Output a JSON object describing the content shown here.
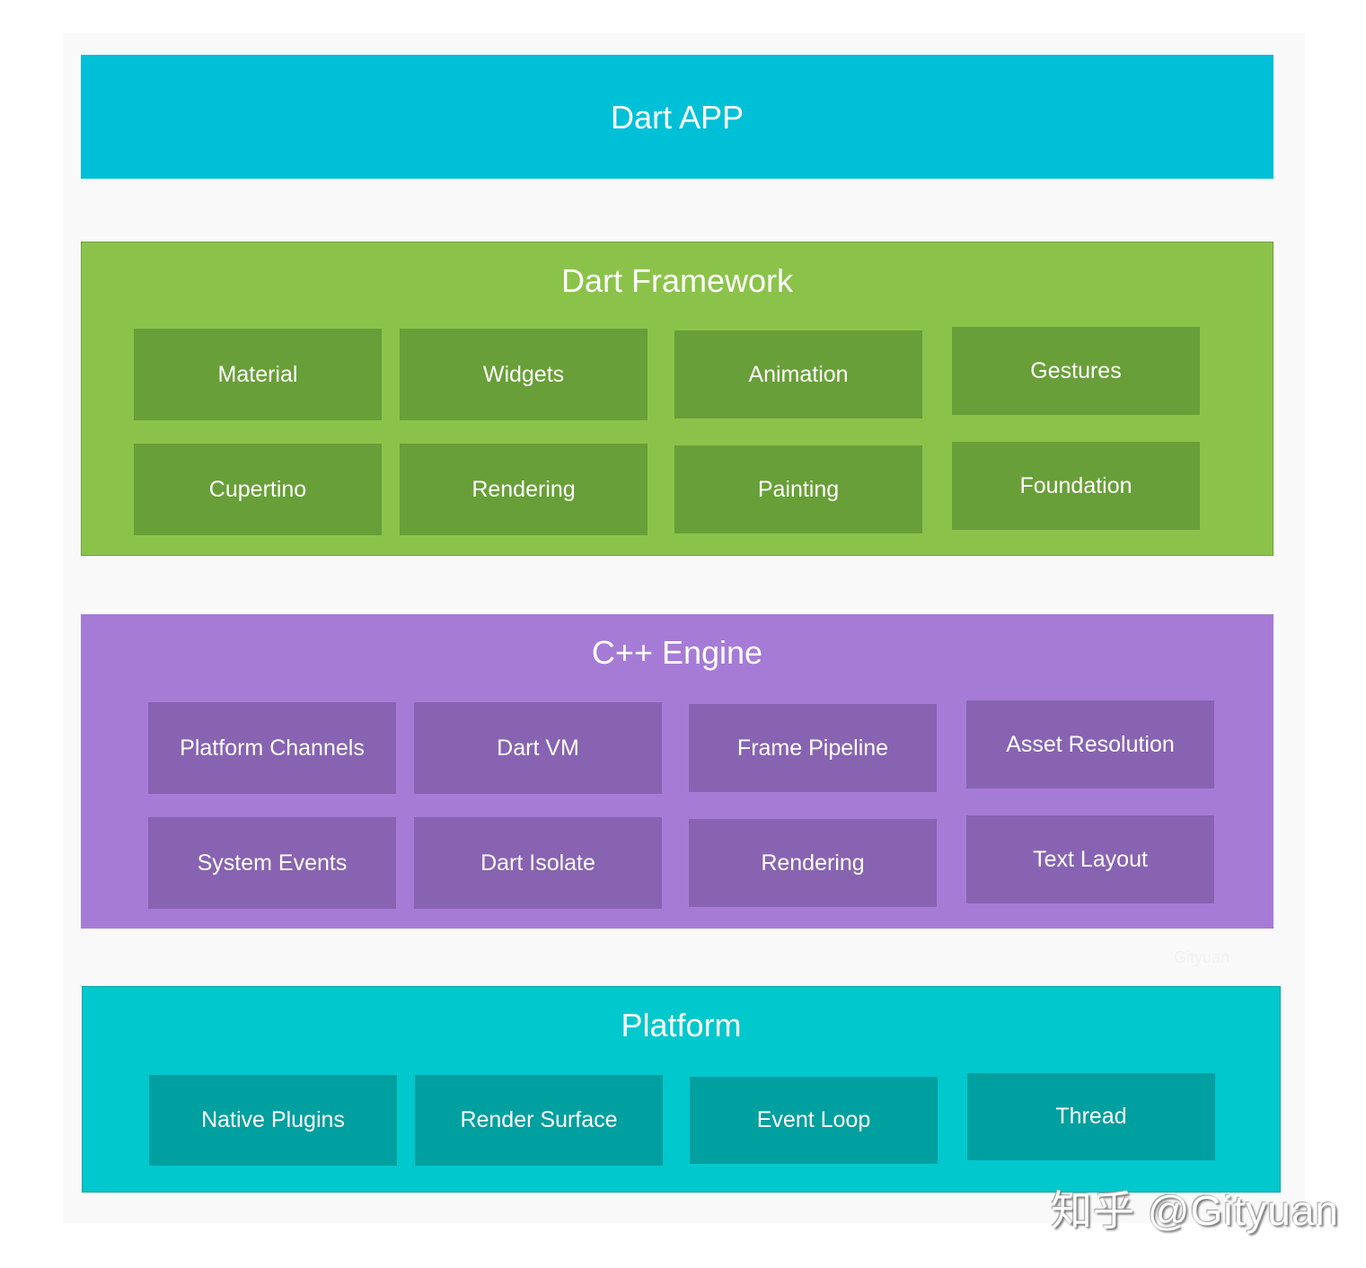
{
  "colors": {
    "background": "#f9f9f9",
    "app_layer": "#00c0d8",
    "framework_layer": "#8bc34a",
    "framework_box": "#689f38",
    "engine_layer": "#a67bd6",
    "engine_box": "#8763b2",
    "platform_layer": "#00c8cc",
    "platform_box": "#009fa0",
    "text": "#ffffff"
  },
  "layers": {
    "app": {
      "title": "Dart APP"
    },
    "framework": {
      "title": "Dart Framework",
      "items": [
        "Material",
        "Widgets",
        "Animation",
        "Gestures",
        "Cupertino",
        "Rendering",
        "Painting",
        "Foundation"
      ]
    },
    "engine": {
      "title": "C++ Engine",
      "items": [
        "Platform Channels",
        "Dart VM",
        "Frame Pipeline",
        "Asset Resolution",
        "System Events",
        "Dart Isolate",
        "Rendering",
        "Text Layout"
      ]
    },
    "platform": {
      "title": "Platform",
      "items": [
        "Native Plugins",
        "Render Surface",
        "Event Loop",
        "Thread"
      ]
    }
  },
  "watermarks": {
    "faint": "Gityuan",
    "zhihu": "知乎 @Gityuan"
  }
}
